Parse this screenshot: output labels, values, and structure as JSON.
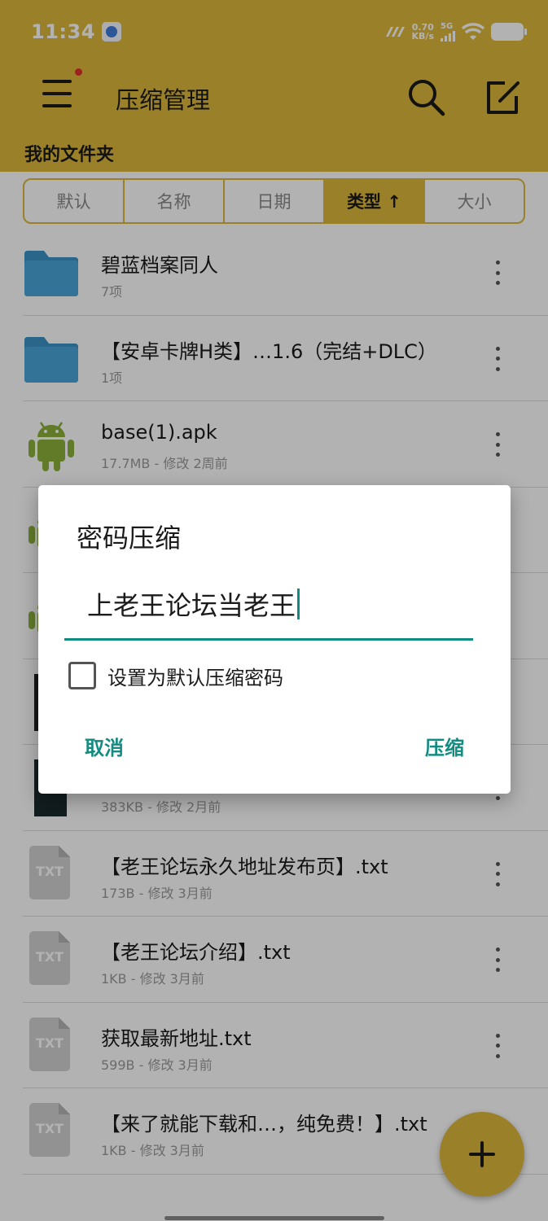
{
  "status_bar": {
    "time": "11:34",
    "net_speed_value": "0.70",
    "net_speed_unit": "KB/s",
    "network": "5G"
  },
  "header": {
    "title": "压缩管理",
    "folder_title": "我的文件夹"
  },
  "sort_tabs": [
    {
      "label": "默认",
      "active": false
    },
    {
      "label": "名称",
      "active": false
    },
    {
      "label": "日期",
      "active": false
    },
    {
      "label": "类型 ↑",
      "active": true
    },
    {
      "label": "大小",
      "active": false
    }
  ],
  "files": [
    {
      "name": "碧蓝档案同人",
      "meta": "7项",
      "icon": "folder-icon"
    },
    {
      "name": "【安卓卡牌H类】…1.6（完结+DLC）",
      "meta": "1项",
      "icon": "folder-icon"
    },
    {
      "name": "base(1).apk",
      "meta": "17.7MB - 修改 2周前",
      "icon": "android-icon"
    },
    {
      "name": "",
      "meta": "",
      "icon": "android-icon"
    },
    {
      "name": "",
      "meta": "",
      "icon": "android-icon"
    },
    {
      "name": "",
      "meta": "",
      "icon": "image-thumbnail"
    },
    {
      "name": "",
      "meta": "383KB - 修改 2月前",
      "icon": "image-thumbnail"
    },
    {
      "name": "【老王论坛永久地址发布页】.txt",
      "meta": "173B - 修改 3月前",
      "icon": "txt-file-icon"
    },
    {
      "name": "【老王论坛介绍】.txt",
      "meta": "1KB - 修改 3月前",
      "icon": "txt-file-icon"
    },
    {
      "name": "获取最新地址.txt",
      "meta": "599B - 修改 3月前",
      "icon": "txt-file-icon"
    },
    {
      "name": "【来了就能下载和…，纯免费！】.txt",
      "meta": "1KB - 修改 3月前",
      "icon": "txt-file-icon"
    }
  ],
  "txt_icon_label": "TXT",
  "dialog": {
    "title": "密码压缩",
    "password_value": "上老王论坛当老王",
    "checkbox_label": "设置为默认压缩密码",
    "checkbox_checked": false,
    "cancel_label": "取消",
    "confirm_label": "压缩"
  },
  "colors": {
    "accent_yellow": "#ddb83a",
    "dialog_teal": "#128b81",
    "folder_blue": "#4aa5d8",
    "android_green": "#8bb03b"
  }
}
